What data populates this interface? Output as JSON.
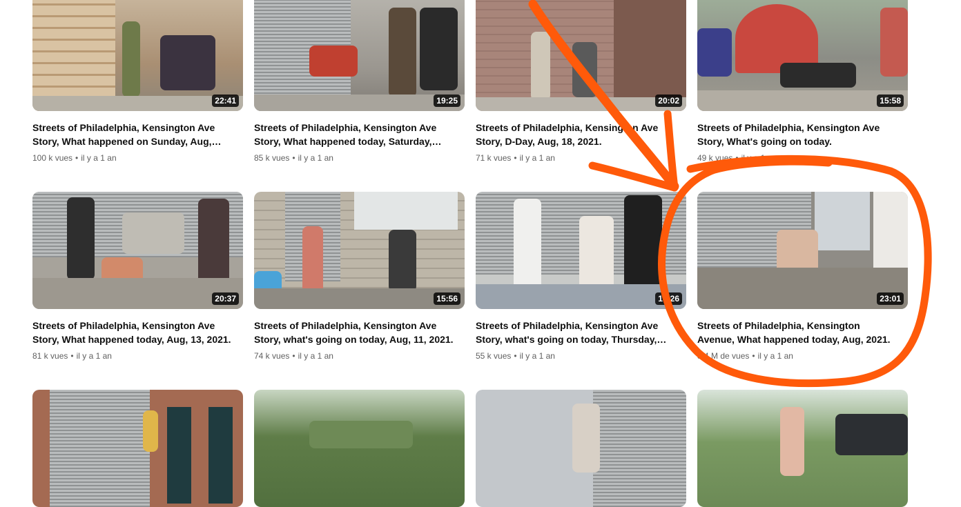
{
  "videos": [
    {
      "title": "Streets of Philadelphia, Kensington Ave Story, What happened on Sunday, Aug, 15,…",
      "duration": "22:41",
      "views": "100 k vues",
      "age": "il y a 1 an"
    },
    {
      "title": "Streets of Philadelphia, Kensington Ave Story, What happened today, Saturday, Aug,…",
      "duration": "19:25",
      "views": "85 k vues",
      "age": "il y a 1 an"
    },
    {
      "title": "Streets of Philadelphia, Kensington Ave Story, D-Day, Aug, 18, 2021.",
      "duration": "20:02",
      "views": "71 k vues",
      "age": "il y a 1 an"
    },
    {
      "title": "Streets of Philadelphia, Kensington Ave Story, What's going on today.",
      "duration": "15:58",
      "views": "49 k vues",
      "age": "il y a 1 an"
    },
    {
      "title": "Streets of Philadelphia, Kensington Ave Story, What happened today, Aug, 13, 2021.",
      "duration": "20:37",
      "views": "81 k vues",
      "age": "il y a 1 an"
    },
    {
      "title": "Streets of Philadelphia, Kensington Ave Story, what's going on today, Aug, 11, 2021.",
      "duration": "15:56",
      "views": "74 k vues",
      "age": "il y a 1 an"
    },
    {
      "title": "Streets of Philadelphia, Kensington Ave Story, what's going on today, Thursday, Aug,…",
      "duration": "16:26",
      "views": "55 k vues",
      "age": "il y a 1 an"
    },
    {
      "title": "Streets of Philadelphia, Kensington Avenue, What happened today, Aug, 2021.",
      "duration": "23:01",
      "views": "5,4 M de vues",
      "age": "il y a 1 an"
    }
  ],
  "meta_separator": "•",
  "annotation_color": "#ff5a0a"
}
